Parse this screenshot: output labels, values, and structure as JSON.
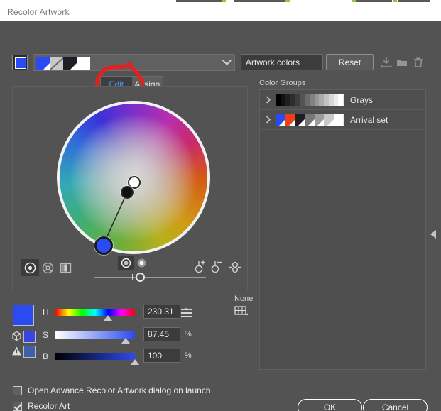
{
  "window": {
    "title": "Recolor Artwork"
  },
  "header": {
    "current_color_swatch": "#2b4bf2",
    "artwork_swatches": [
      "#2b4bf2",
      "#c8c8c8",
      "#1d1f24",
      "#ffffff"
    ],
    "dropdown_icon": "chevron-down-icon"
  },
  "tabs": [
    {
      "label": "Edit",
      "active": true
    },
    {
      "label": "Assign",
      "active": false
    }
  ],
  "annotation": {
    "type": "red-circle-highlight",
    "target": "Edit",
    "color": "#e81f1f"
  },
  "wheel": {
    "view_modes": [
      {
        "name": "smooth-color-wheel",
        "active": true
      },
      {
        "name": "segmented-color-wheel",
        "active": false
      },
      {
        "name": "color-bars",
        "active": false
      }
    ],
    "markers": [
      {
        "name": "white-handle",
        "color": "#ffffff"
      },
      {
        "name": "black-handle",
        "color": "#101010"
      },
      {
        "name": "base-color-handle",
        "color": "#2b4bf2"
      }
    ],
    "radio_modes": [
      {
        "name": "display-saturation-brightness",
        "active": true
      },
      {
        "name": "display-hue-only",
        "active": false
      }
    ],
    "stop_tools": [
      "add-color-icon",
      "remove-color-icon",
      "link-harmony-icon"
    ]
  },
  "hsb": {
    "preview_swatch": "#2b4bf2",
    "cube_swatch": "#3b45e0",
    "warning_swatch": "#3f5fa8",
    "none_label": "None",
    "grid_icon": "color-grid-icon",
    "menu_icon": "hamburger-menu-icon",
    "sliders": [
      {
        "label": "H",
        "value": "230.31",
        "unit": "°",
        "percent": 64
      },
      {
        "label": "S",
        "value": "87.45",
        "unit": "%",
        "percent": 87
      },
      {
        "label": "B",
        "value": "100",
        "unit": "%",
        "percent": 100
      }
    ]
  },
  "right_panel": {
    "name_value": "Artwork colors",
    "reset_label": "Reset",
    "tool_icons": [
      "save-to-library-icon",
      "new-folder-icon",
      "delete-icon"
    ],
    "color_groups_label": "Color Groups",
    "groups": [
      {
        "name": "Grays",
        "expand_icon": "chevron-right-icon",
        "colors": [
          "#000000",
          "#111111",
          "#1f1f1f",
          "#2e2e2e",
          "#3d3d3d",
          "#545454",
          "#6b6b6b",
          "#818181",
          "#979797",
          "#adadad",
          "#c3c3c3",
          "#d7d7d7",
          "#ebebeb",
          "#ffffff"
        ],
        "cut_corners": false
      },
      {
        "name": "Arrival set",
        "expand_icon": "chevron-right-icon",
        "colors": [
          "#2b4bf2",
          "#ef4013",
          "#1d1f24",
          "#787878",
          "#9c9c9c",
          "#c9c9c9",
          "#ffffff"
        ],
        "cut_corners": true
      }
    ],
    "collapse_icon": "collapse-panel-left-icon"
  },
  "footer": {
    "checkbox_launch": {
      "label": "Open Advance Recolor Artwork dialog on launch",
      "checked": false
    },
    "checkbox_recolor": {
      "label": "Recolor Art",
      "checked": true
    },
    "ok_label": "OK",
    "cancel_label": "Cancel"
  }
}
